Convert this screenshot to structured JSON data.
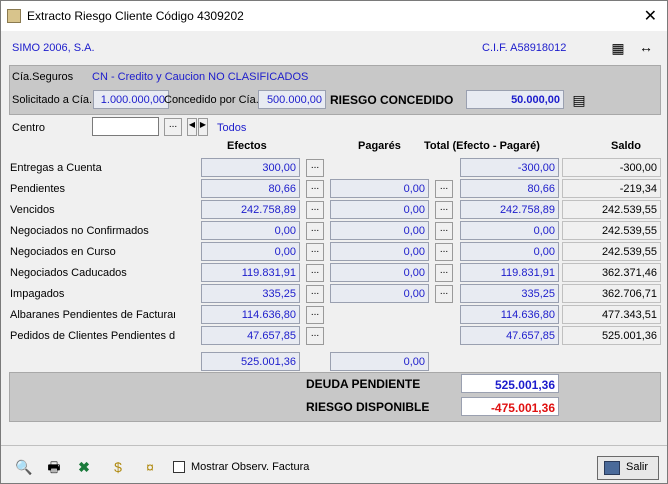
{
  "window": {
    "title": "Extracto Riesgo Cliente Código 4309202"
  },
  "header": {
    "company": "SIMO 2006, S.A.",
    "cif": "C.I.F. A58918012"
  },
  "seguro": {
    "cia_label": "Cía.Seguros",
    "cia_value": "CN - Credito y Caucion NO CLASIFICADOS",
    "solicitado_label": "Solicitado a Cía.",
    "solicitado_value": "1.000.000,00",
    "concedido_label": "Concedido por Cía.",
    "concedido_value": "500.000,00",
    "riesgo_label": "RIESGO CONCEDIDO",
    "riesgo_value": "50.000,00"
  },
  "centro": {
    "label": "Centro",
    "value": "",
    "todos": "Todos",
    "ellipsis": "..."
  },
  "columns": {
    "efectos": "Efectos",
    "pagares": "Pagarés",
    "total": "Total (Efecto - Pagaré)",
    "saldo": "Saldo"
  },
  "rows": [
    {
      "label": "Entregas a Cuenta",
      "efectos": "300,00",
      "pagares": "",
      "total": "-300,00",
      "saldo": "-300,00"
    },
    {
      "label": "Pendientes",
      "efectos": "80,66",
      "pagares": "0,00",
      "total": "80,66",
      "saldo": "-219,34"
    },
    {
      "label": "Vencidos",
      "efectos": "242.758,89",
      "pagares": "0,00",
      "total": "242.758,89",
      "saldo": "242.539,55"
    },
    {
      "label": "Negociados no Confirmados",
      "efectos": "0,00",
      "pagares": "0,00",
      "total": "0,00",
      "saldo": "242.539,55"
    },
    {
      "label": "Negociados en Curso",
      "efectos": "0,00",
      "pagares": "0,00",
      "total": "0,00",
      "saldo": "242.539,55"
    },
    {
      "label": "Negociados Caducados",
      "efectos": "119.831,91",
      "pagares": "0,00",
      "total": "119.831,91",
      "saldo": "362.371,46"
    },
    {
      "label": "Impagados",
      "efectos": "335,25",
      "pagares": "0,00",
      "total": "335,25",
      "saldo": "362.706,71"
    },
    {
      "label": "Albaranes Pendientes de Facturar",
      "efectos": "114.636,80",
      "pagares": "",
      "total": "114.636,80",
      "saldo": "477.343,51"
    },
    {
      "label": "Pedidos de Clientes Pendientes de",
      "efectos": "47.657,85",
      "pagares": "",
      "total": "47.657,85",
      "saldo": "525.001,36"
    }
  ],
  "totals": {
    "efectos": "525.001,36",
    "pagares": "0,00",
    "deuda_label": "DEUDA PENDIENTE",
    "deuda_value": "525.001,36",
    "riesgo_disp_label": "RIESGO DISPONIBLE",
    "riesgo_disp_value": "-475.001,36"
  },
  "footer": {
    "mostrar_label": "Mostrar Observ. Factura",
    "salir_label": "Salir"
  },
  "colors": {
    "blue_text": "#1c1ccc",
    "red_text": "#e01010"
  }
}
